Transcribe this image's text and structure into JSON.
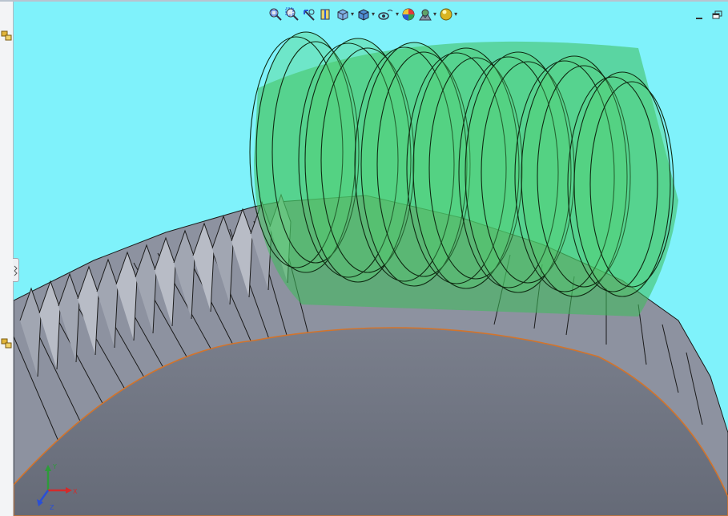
{
  "app": {
    "colors": {
      "background": "#7ff2fb",
      "gear_body": "#6c717f",
      "gear_teeth": "#8a8f9c",
      "worm": "#3fcf6a",
      "rim_edge": "#d2742c"
    }
  },
  "toolbar": {
    "buttons": [
      {
        "id": "zoom-to-fit",
        "icon": "zoom-to-fit-icon",
        "dropdown": false
      },
      {
        "id": "zoom-to-area",
        "icon": "zoom-to-area-icon",
        "dropdown": false
      },
      {
        "id": "previous-view",
        "icon": "previous-view-icon",
        "dropdown": false
      },
      {
        "id": "section-view",
        "icon": "section-view-icon",
        "dropdown": false
      },
      {
        "id": "view-orientation",
        "icon": "view-orientation-icon",
        "dropdown": true
      },
      {
        "id": "display-style",
        "icon": "display-style-icon",
        "dropdown": true
      },
      {
        "id": "hide-show-items",
        "icon": "hide-show-items-icon",
        "dropdown": true
      },
      {
        "id": "edit-appearance",
        "icon": "edit-appearance-icon",
        "dropdown": false
      },
      {
        "id": "apply-scene",
        "icon": "apply-scene-icon",
        "dropdown": true
      },
      {
        "id": "view-settings",
        "icon": "view-settings-icon",
        "dropdown": true
      }
    ]
  },
  "window_controls": {
    "minimize": "minimize-icon",
    "restore": "restore-icon"
  },
  "triad": {
    "x_label": "X",
    "y_label": "Y",
    "z_label": "Z"
  }
}
